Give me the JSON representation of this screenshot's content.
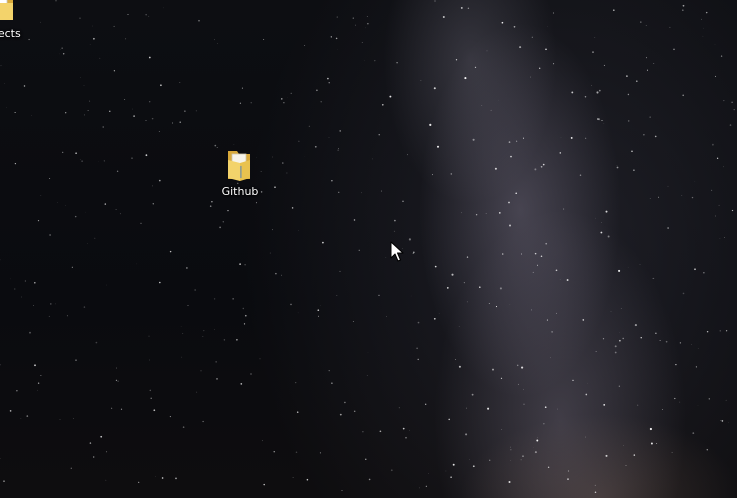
{
  "desktop": {
    "wallpaper": "milky-way-night-sky",
    "icons": [
      {
        "label": "Projects",
        "icon": "folder-icon"
      },
      {
        "label": "Github",
        "icon": "folder-icon"
      }
    ]
  },
  "cursor": {
    "icon": "mouse-pointer-icon"
  },
  "colors": {
    "folder_front": "#f3d36b",
    "folder_back": "#d9a93a",
    "label_text": "#ffffff"
  }
}
